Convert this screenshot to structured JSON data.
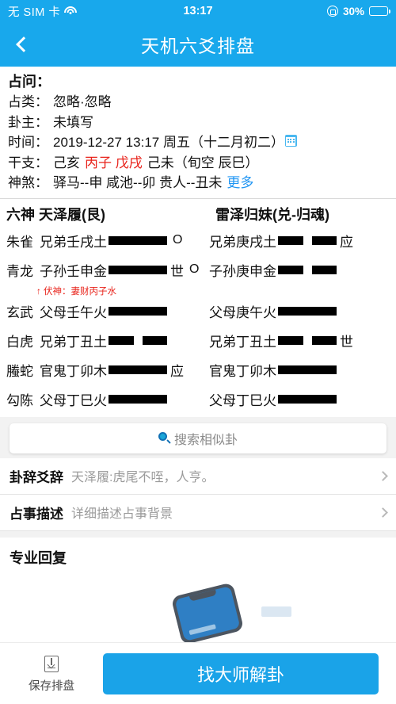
{
  "statusbar": {
    "carrier": "无 SIM 卡",
    "time": "13:17",
    "battery_percent": "30%",
    "battery_level": 30,
    "wifi_icon": "wifi-icon",
    "rotation_lock_icon": "rotation-lock-icon",
    "battery_icon": "battery-icon"
  },
  "navbar": {
    "back_icon": "chevron-left-icon",
    "title": "天机六爻排盘"
  },
  "info": {
    "heading": "占问：",
    "rows": [
      {
        "label": "占类：",
        "value": "忽略·忽略"
      },
      {
        "label": "卦主：",
        "value": "未填写"
      },
      {
        "label": "时间：",
        "value": "2019-12-27 13:17 周五（十二月初二）"
      },
      {
        "label": "干支：",
        "value": ""
      },
      {
        "label": "神煞：",
        "value": "驿马--申  咸池--卯  贵人--丑未"
      }
    ],
    "calendar_icon": "calendar-icon",
    "ganzhi": {
      "part1": "己亥",
      "part2_red": "丙子 戊戌",
      "part3": "己未（旬空 辰巳）"
    },
    "shensha_more": "更多"
  },
  "hexagram": {
    "left_header_god": "六神",
    "left_header_name": "天泽履(艮)",
    "right_header_name": "雷泽归妹(兑-归魂)",
    "fushen_note": "↑ 伏神：妻财丙子水",
    "rows": [
      {
        "god": "朱雀",
        "left_text": "兄弟壬戌土",
        "left_line": "solid",
        "left_mark": "",
        "left_change": "O",
        "right_text": "兄弟庚戌土",
        "right_line": "broken",
        "right_mark": "应"
      },
      {
        "god": "青龙",
        "left_text": "子孙壬申金",
        "left_line": "solid",
        "left_mark": "世",
        "left_change": "O",
        "right_text": "子孙庚申金",
        "right_line": "broken",
        "right_mark": ""
      },
      {
        "god": "玄武",
        "left_text": "父母壬午火",
        "left_line": "solid",
        "left_mark": "",
        "left_change": "",
        "right_text": "父母庚午火",
        "right_line": "solid",
        "right_mark": ""
      },
      {
        "god": "白虎",
        "left_text": "兄弟丁丑土",
        "left_line": "broken",
        "left_mark": "",
        "left_change": "",
        "right_text": "兄弟丁丑土",
        "right_line": "broken",
        "right_mark": "世"
      },
      {
        "god": "螣蛇",
        "left_text": "官鬼丁卯木",
        "left_line": "solid",
        "left_mark": "应",
        "left_change": "",
        "right_text": "官鬼丁卯木",
        "right_line": "solid",
        "right_mark": ""
      },
      {
        "god": "勾陈",
        "left_text": "父母丁巳火",
        "left_line": "solid",
        "left_mark": "",
        "left_change": "",
        "right_text": "父母丁巳火",
        "right_line": "solid",
        "right_mark": ""
      }
    ]
  },
  "search": {
    "icon": "search-icon",
    "label": "搜索相似卦"
  },
  "list": [
    {
      "label": "卦辞爻辞",
      "value": "天泽履:虎尾不咥，人亨。",
      "chevron": "chevron-right-icon"
    },
    {
      "label": "占事描述",
      "value": "详细描述占事背景",
      "chevron": "chevron-right-icon"
    }
  ],
  "pro": {
    "title": "专业回复",
    "phone_illustration": "phone-illustration"
  },
  "bottom": {
    "save_icon": "save-icon",
    "save_label": "保存排盘",
    "master_label": "找大师解卦"
  },
  "colors": {
    "brand_blue": "#18a8ec",
    "button_blue": "#1aa3e8",
    "red_accent": "#e8221a",
    "link_blue": "#2196f3"
  }
}
